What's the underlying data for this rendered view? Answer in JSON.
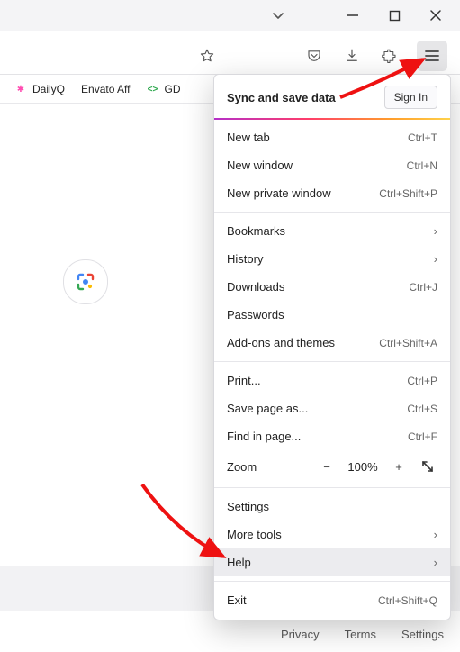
{
  "window": {
    "chevron": "⌄"
  },
  "toolbar": {},
  "bookmarks": [
    {
      "label": "DailyQ",
      "color": "#ff4db1"
    },
    {
      "label": "Envato Aff",
      "color": "#82b440"
    },
    {
      "label": "GD",
      "color": "#2aa64a"
    }
  ],
  "menu": {
    "sync_label": "Sync and save data",
    "sign_in": "Sign In",
    "items": [
      {
        "label": "New tab",
        "shortcut": "Ctrl+T"
      },
      {
        "label": "New window",
        "shortcut": "Ctrl+N"
      },
      {
        "label": "New private window",
        "shortcut": "Ctrl+Shift+P"
      }
    ],
    "items2": [
      {
        "label": "Bookmarks",
        "chev": true
      },
      {
        "label": "History",
        "chev": true
      },
      {
        "label": "Downloads",
        "shortcut": "Ctrl+J"
      },
      {
        "label": "Passwords"
      },
      {
        "label": "Add-ons and themes",
        "shortcut": "Ctrl+Shift+A"
      }
    ],
    "items3": [
      {
        "label": "Print...",
        "shortcut": "Ctrl+P"
      },
      {
        "label": "Save page as...",
        "shortcut": "Ctrl+S"
      },
      {
        "label": "Find in page...",
        "shortcut": "Ctrl+F"
      }
    ],
    "zoom": {
      "label": "Zoom",
      "percent": "100%"
    },
    "items4": [
      {
        "label": "Settings"
      },
      {
        "label": "More tools",
        "chev": true
      },
      {
        "label": "Help",
        "chev": true,
        "hover": true
      }
    ],
    "exit": {
      "label": "Exit",
      "shortcut": "Ctrl+Shift+Q"
    }
  },
  "footer": {
    "links": [
      "Privacy",
      "Terms",
      "Settings"
    ]
  }
}
